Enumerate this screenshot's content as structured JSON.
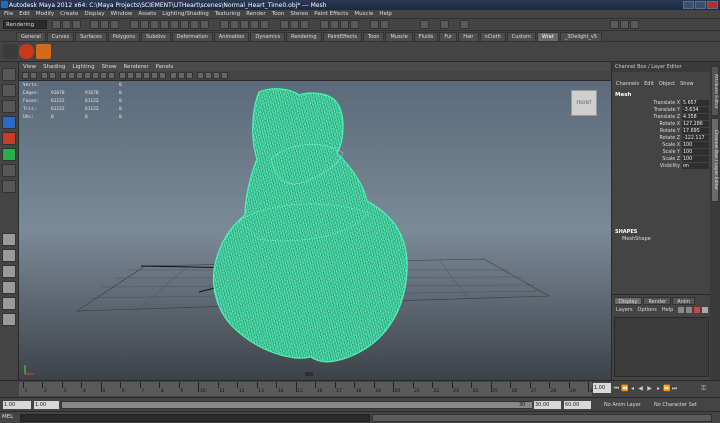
{
  "window": {
    "title": "Autodesk Maya 2012 x64: C:\\Maya Projects\\SCIEMENT\\UTHeart\\scenes\\Normal_Heart_Time0.obj*   ---   Mesh"
  },
  "menubar": {
    "items": [
      "File",
      "Edit",
      "Modify",
      "Create",
      "Display",
      "Window",
      "Assets",
      "Lighting/Shading",
      "Texturing",
      "Render",
      "Toon",
      "Stereo",
      "Paint Effects",
      "Muscle",
      "Help"
    ]
  },
  "statusline": {
    "mode": "Rendering"
  },
  "shelf": {
    "tabs": [
      "General",
      "Curves",
      "Surfaces",
      "Polygons",
      "Subdivs",
      "Deformation",
      "Animation",
      "Dynamics",
      "Rendering",
      "PaintEffects",
      "Toon",
      "Muscle",
      "Fluids",
      "Fur",
      "Hair",
      "nCloth",
      "Custom",
      "Wrat",
      "_3Delight_v5"
    ],
    "active_tab": "Wrat"
  },
  "viewport": {
    "menu": [
      "View",
      "Shading",
      "Lighting",
      "Show",
      "Renderer",
      "Panels"
    ],
    "hud": [
      {
        "label": "Verts:",
        "v1": "",
        "v2": "",
        "v3": "0"
      },
      {
        "label": "Edges:",
        "v1": "91678",
        "v2": "91678",
        "v3": "0"
      },
      {
        "label": "Faces:",
        "v1": "61122",
        "v2": "61122",
        "v3": "0"
      },
      {
        "label": "Tris:",
        "v1": "61122",
        "v2": "61122",
        "v3": "0"
      },
      {
        "label": "UVs:",
        "v1": "0",
        "v2": "0",
        "v3": "0"
      }
    ],
    "viewcube": "FRONT",
    "wire_color": "#3ef0a2"
  },
  "channel_box": {
    "header": "Channel Box / Layer Editor",
    "menu": [
      "Channels",
      "Edit",
      "Object",
      "Show"
    ],
    "object": "Mesh",
    "channels": [
      {
        "name": "Translate X",
        "value": "5.657"
      },
      {
        "name": "Translate Y",
        "value": "-3.634"
      },
      {
        "name": "Translate Z",
        "value": "4.358"
      },
      {
        "name": "Rotate X",
        "value": "127.286"
      },
      {
        "name": "Rotate Y",
        "value": "17.695"
      },
      {
        "name": "Rotate Z",
        "value": "-122.117"
      },
      {
        "name": "Scale X",
        "value": "100"
      },
      {
        "name": "Scale Y",
        "value": "100"
      },
      {
        "name": "Scale Z",
        "value": "100"
      },
      {
        "name": "Visibility",
        "value": "on"
      }
    ],
    "shapes_label": "SHAPES",
    "shape_name": "MeshShape"
  },
  "side_tabs": [
    "Attribute Editor",
    "Channel Box / Layer Editor"
  ],
  "layer_editor": {
    "tabs": [
      "Display",
      "Render",
      "Anim"
    ],
    "active_tab": "Display",
    "menu": [
      "Layers",
      "Options",
      "Help"
    ]
  },
  "timeline": {
    "ticks": [
      "1",
      "2",
      "3",
      "4",
      "5",
      "6",
      "7",
      "8",
      "9",
      "10",
      "11",
      "12",
      "13",
      "14",
      "15",
      "16",
      "17",
      "18",
      "19",
      "20",
      "21",
      "22",
      "23",
      "24",
      "25",
      "26",
      "27",
      "28",
      "29",
      "30"
    ],
    "current_frame": "1.00"
  },
  "range": {
    "start": "1.00",
    "inner_start": "1.00",
    "inner_end_label": "30",
    "end": "30.00",
    "end2": "60.00",
    "anim_layer": "No Anim Layer",
    "character_set": "No Character Set"
  },
  "cmdline": {
    "type": "MEL"
  }
}
